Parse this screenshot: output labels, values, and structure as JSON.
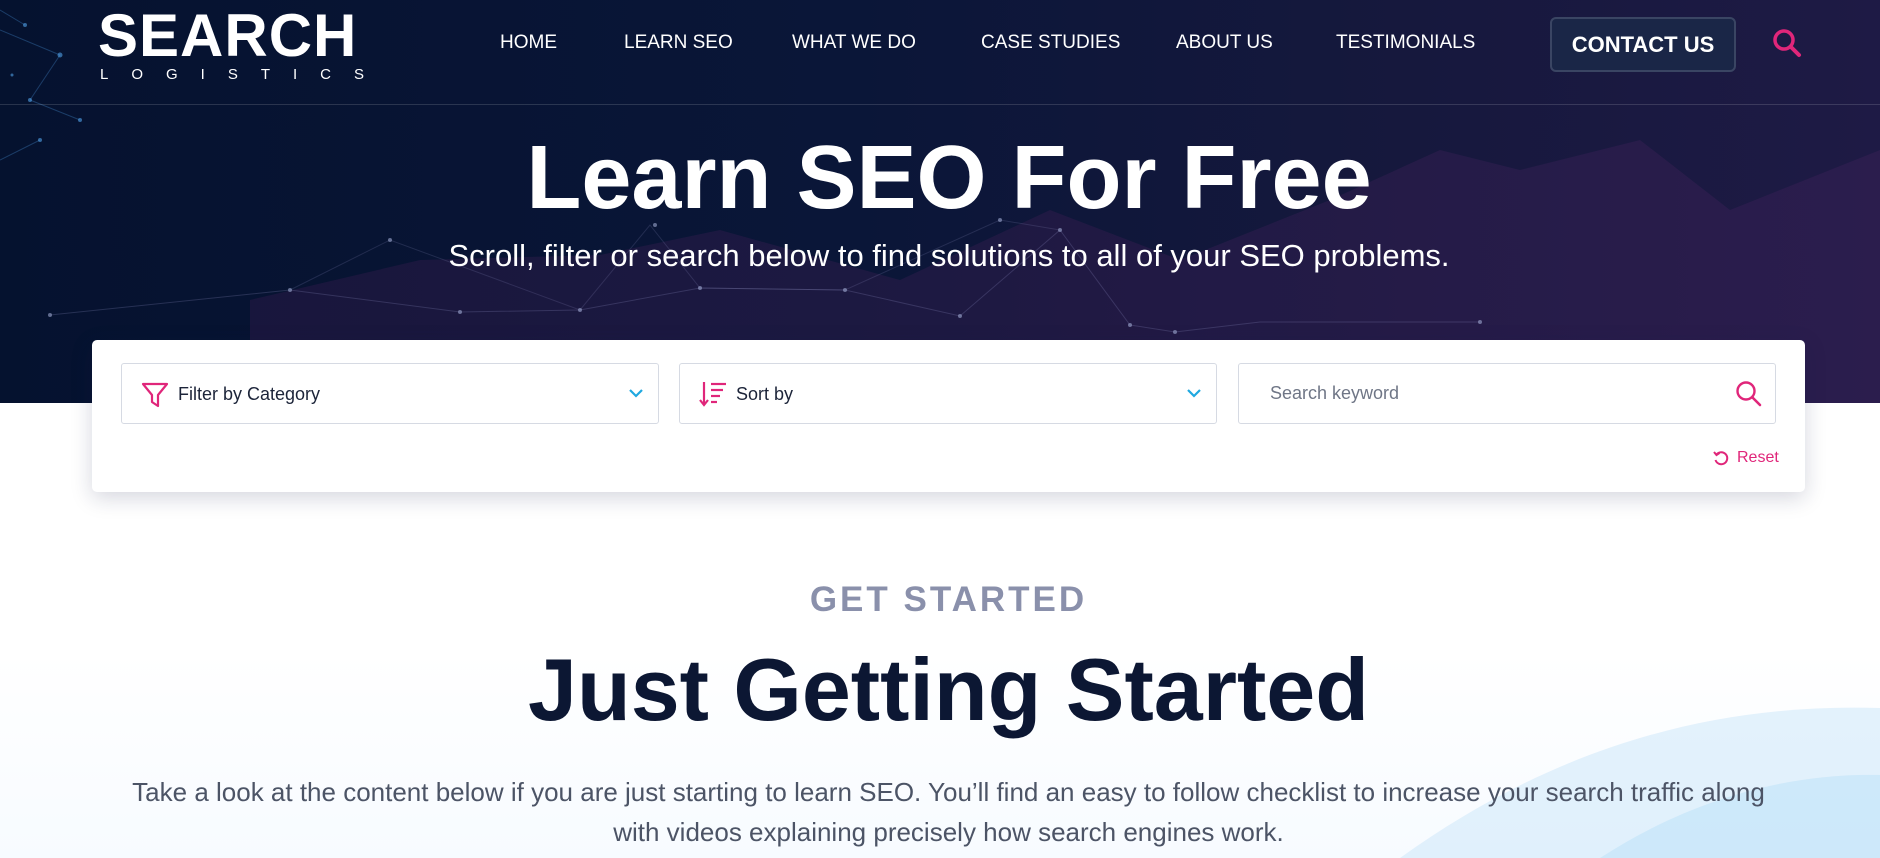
{
  "header": {
    "logo": {
      "main": "SEARCH",
      "sub": "LOGISTICS"
    },
    "nav": [
      {
        "label": "HOME"
      },
      {
        "label": "LEARN SEO"
      },
      {
        "label": "WHAT WE DO"
      },
      {
        "label": "CASE STUDIES"
      },
      {
        "label": "ABOUT US"
      },
      {
        "label": "TESTIMONIALS"
      }
    ],
    "contact_label": "CONTACT US",
    "search_icon": "search-icon"
  },
  "hero": {
    "title": "Learn SEO For Free",
    "subtitle": "Scroll, filter or search below to find solutions to all of your SEO problems."
  },
  "filters": {
    "category": {
      "label": "Filter by Category",
      "icon": "filter-icon"
    },
    "sort": {
      "label": "Sort by",
      "icon": "sort-icon"
    },
    "search": {
      "value": "",
      "placeholder": "Search keyword",
      "icon": "search-icon"
    },
    "reset_label": "Reset"
  },
  "section": {
    "eyebrow": "GET STARTED",
    "title": "Just Getting Started",
    "body": "Take a look at the content below if you are just starting to learn SEO. You’ll find an easy to follow checklist to increase your search traffic along with videos explaining precisely how search engines work."
  },
  "colors": {
    "navy": "#05122f",
    "accent_pink": "#e0267a",
    "chevron_blue": "#1fa8e0",
    "eyebrow_gray": "#8a90ab",
    "heading_navy": "#0c1733"
  }
}
